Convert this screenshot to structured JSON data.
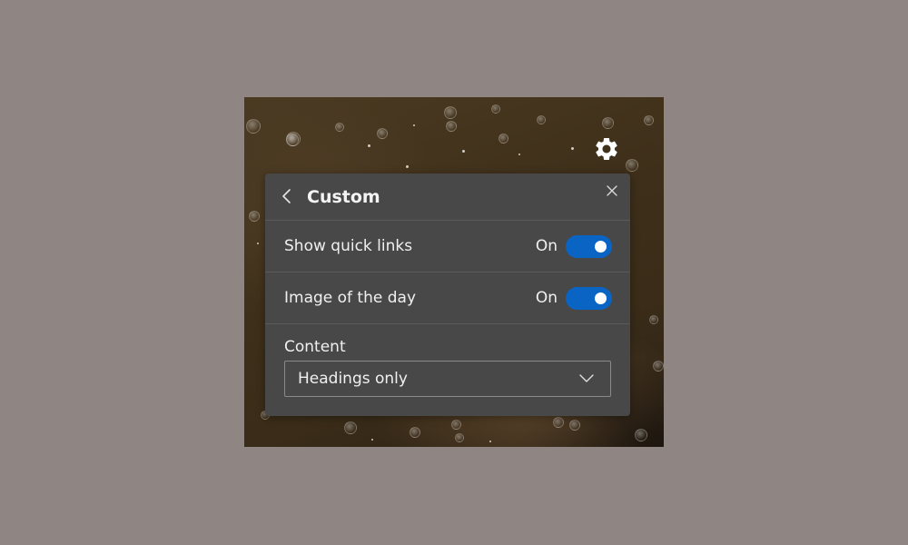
{
  "panel": {
    "title": "Custom",
    "back_icon": "chevron-left-icon",
    "close_icon": "close-icon",
    "settings_icon": "gear-icon"
  },
  "settings": [
    {
      "label": "Show quick links",
      "state": "On",
      "enabled": true
    },
    {
      "label": "Image of the day",
      "state": "On",
      "enabled": true
    }
  ],
  "content": {
    "label": "Content",
    "selected": "Headings only",
    "chevron_icon": "chevron-down-icon"
  },
  "colors": {
    "toggle_on": "#0a64c4",
    "panel_bg": "#484848",
    "page_bg": "#8f8583"
  }
}
